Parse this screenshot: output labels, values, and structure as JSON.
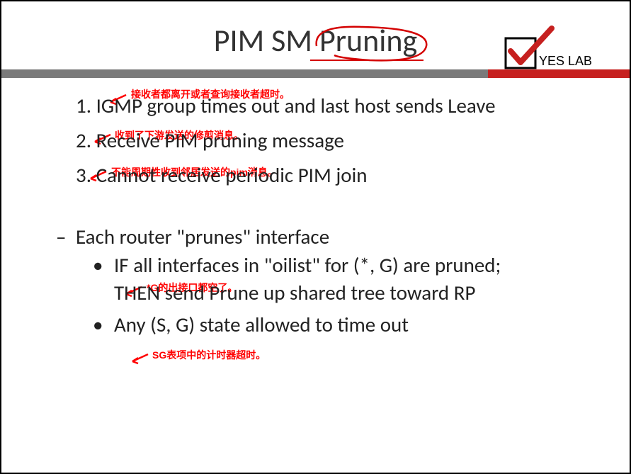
{
  "title": "PIM SM Pruning",
  "logo_text": "YES LAB",
  "items": {
    "item1": "1. IGMP group times out and last host sends Leave",
    "item2": "2. Receive PIM pruning message",
    "item3": "3. Cannot receive periodic PIM join",
    "dash": "Each router \"prunes\" interface",
    "sub1_line1": "IF all interfaces in \"oilist\" for (*, G) are pruned;",
    "sub1_line2": "THEN send Prune up shared tree toward RP",
    "sub2": "Any (S, G) state allowed to time out"
  },
  "annotations": {
    "a1": "接收者都离开或者查询接收者超时。",
    "a2": "收到了下游发送的修剪消息。",
    "a3": "不能周期性收到邻居发送的pim消息。",
    "a4": "*G的出接口都空了。",
    "a5": "SG表项中的计时器超时。"
  }
}
